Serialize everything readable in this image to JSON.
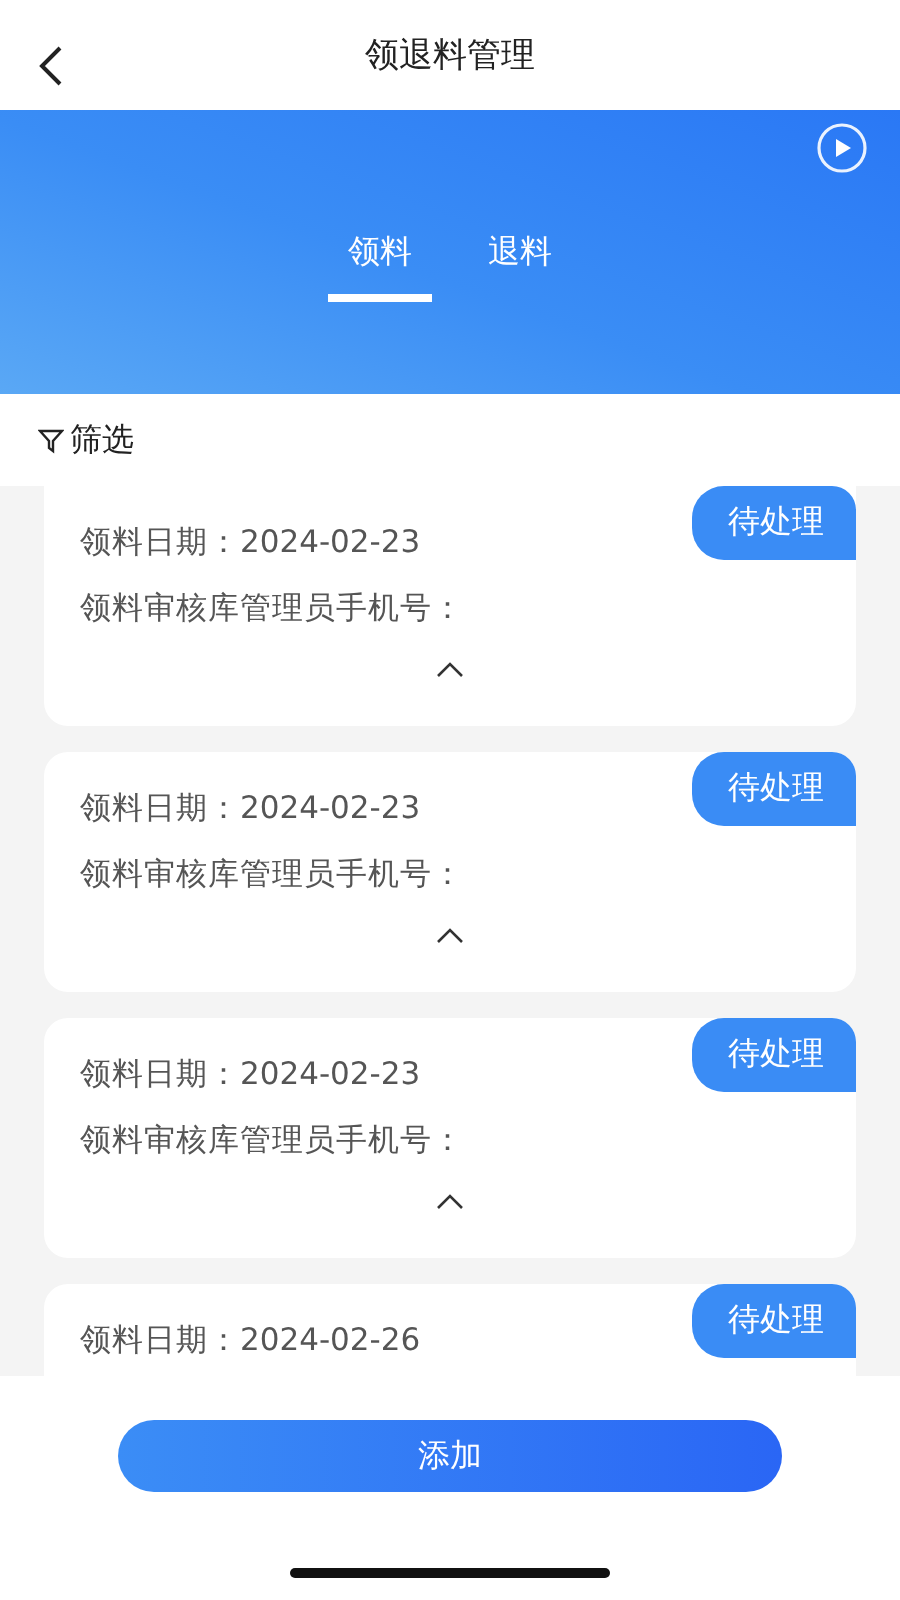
{
  "header": {
    "title": "领退料管理"
  },
  "tabs": [
    {
      "label": "领料",
      "selected": true
    },
    {
      "label": "退料",
      "selected": false
    }
  ],
  "filter": {
    "label": "筛选"
  },
  "records": [
    {
      "status": "待处理",
      "lines": [
        "领料日期：2024-02-23",
        "领料审核库管理员手机号："
      ],
      "expanded": true
    },
    {
      "status": "待处理",
      "lines": [
        "领料日期：2024-02-23",
        "领料审核库管理员手机号："
      ],
      "expanded": true
    },
    {
      "status": "待处理",
      "lines": [
        "领料日期：2024-02-23",
        "领料审核库管理员手机号："
      ],
      "expanded": true
    },
    {
      "status": "待处理",
      "lines": [
        "领料日期：2024-02-26"
      ]
    }
  ],
  "add_button": "添加"
}
